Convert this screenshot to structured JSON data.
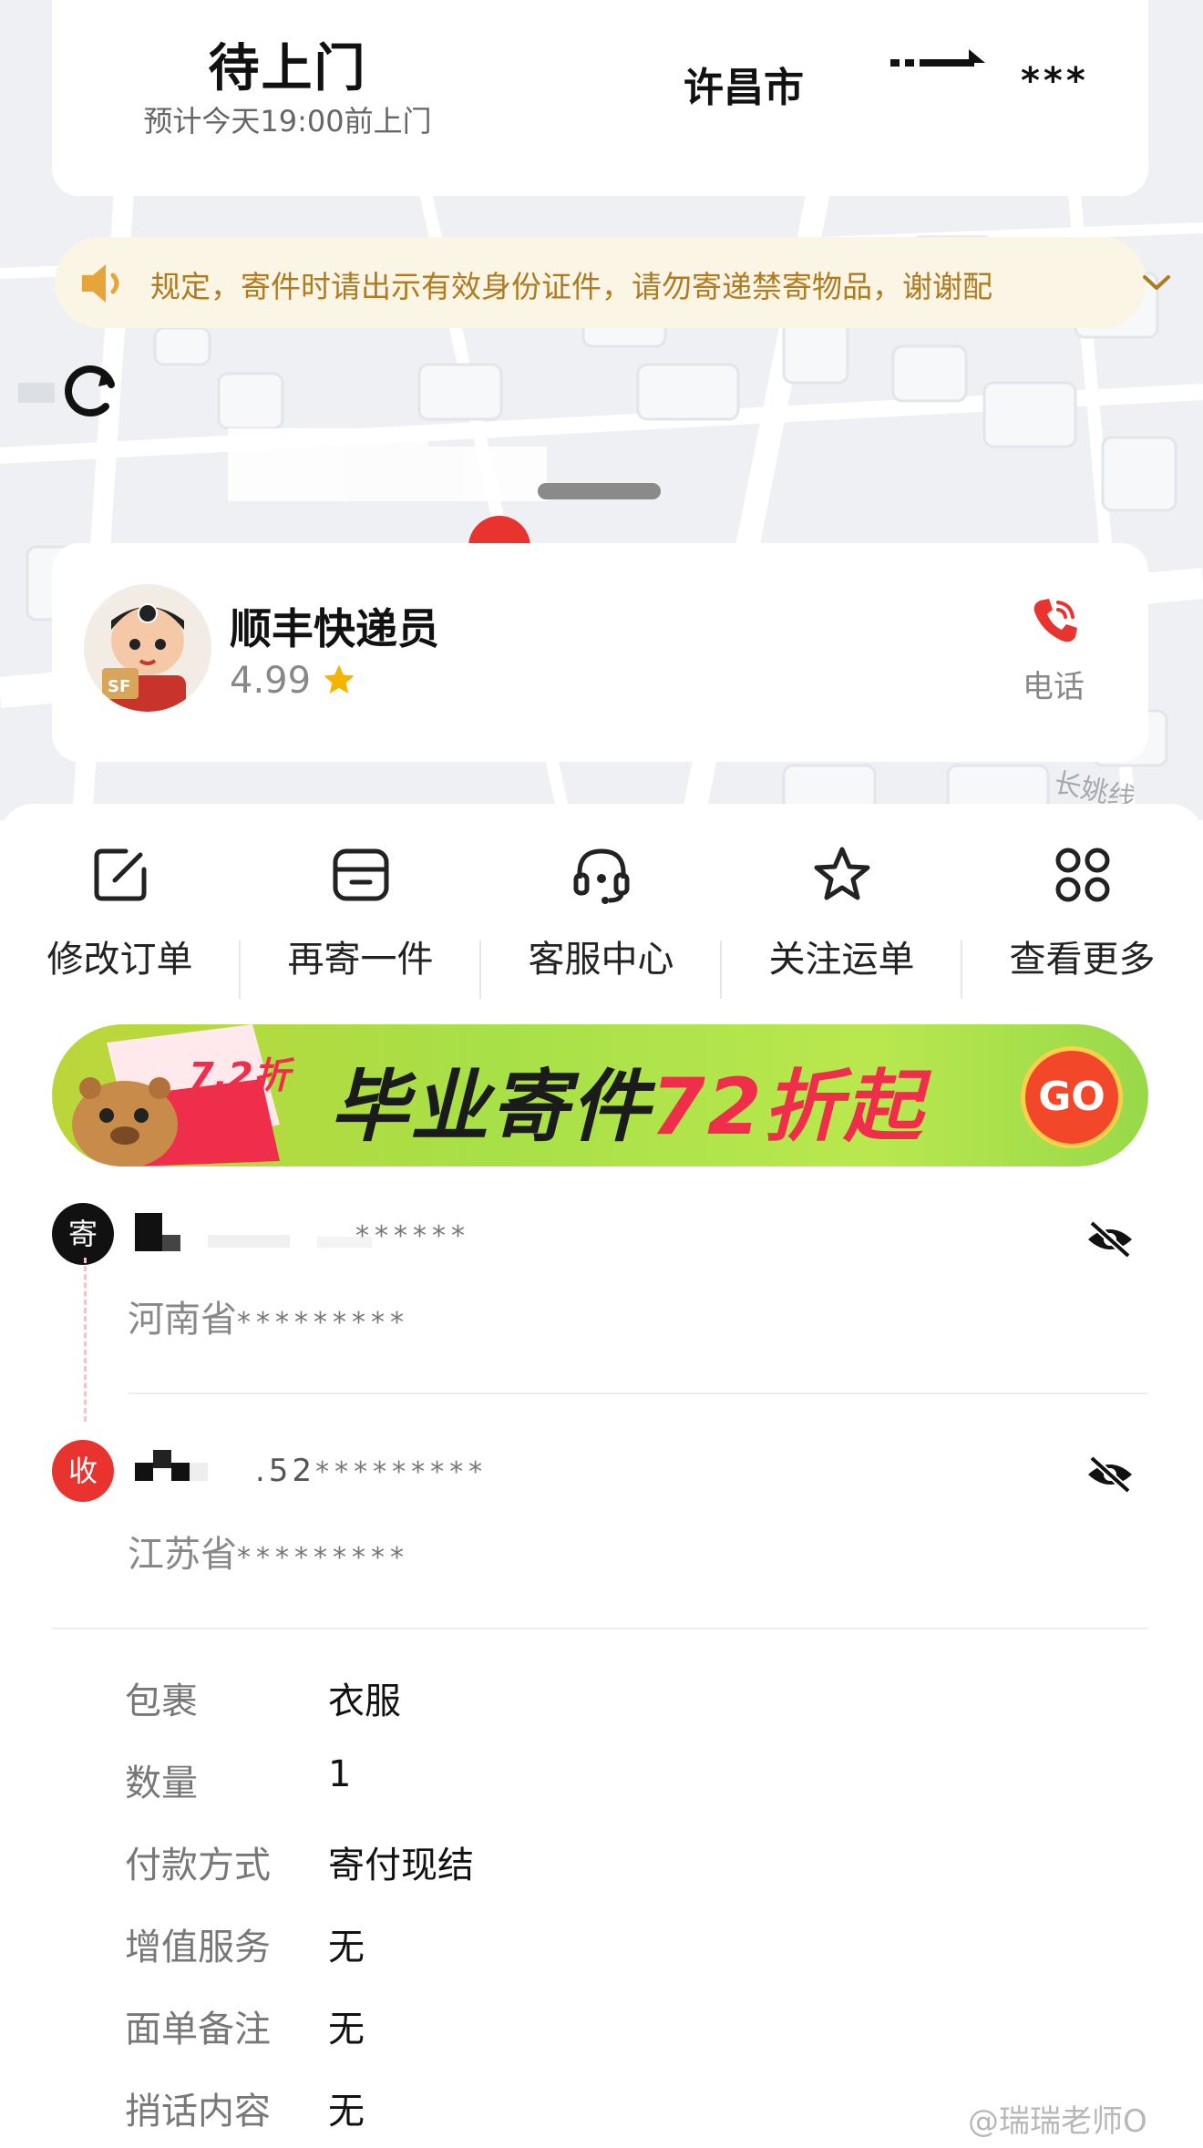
{
  "status": {
    "title": "待上门",
    "subtitle": "预计今天19:00前上门",
    "origin_city": "许昌市",
    "destination_masked": "***"
  },
  "notice": {
    "text": "规定，寄件时请出示有效身份证件，请勿寄递禁寄物品，谢谢配"
  },
  "map": {
    "road_label": "长姚线"
  },
  "courier": {
    "name": "顺丰快递员",
    "rating": "4.99",
    "phone_label": "电话"
  },
  "actions": [
    {
      "label": "修改订单",
      "icon": "edit-icon"
    },
    {
      "label": "再寄一件",
      "icon": "box-icon"
    },
    {
      "label": "客服中心",
      "icon": "headset-icon"
    },
    {
      "label": "关注运单",
      "icon": "star-icon"
    },
    {
      "label": "查看更多",
      "icon": "grid-icon"
    }
  ],
  "banner": {
    "text_prefix": "毕业寄件",
    "text_highlight": "72折起",
    "badge": "7.2折",
    "go_label": "GO"
  },
  "sender": {
    "badge": "寄",
    "phone_masked": "******",
    "province": "河南省",
    "address_masked": "*********"
  },
  "receiver": {
    "badge": "收",
    "phone_partial": ".52",
    "phone_masked": "*********",
    "province": "江苏省",
    "address_masked": "*********"
  },
  "details": [
    {
      "label": "包裹",
      "value": "衣服"
    },
    {
      "label": "数量",
      "value": "1"
    },
    {
      "label": "付款方式",
      "value": "寄付现结"
    },
    {
      "label": "增值服务",
      "value": "无"
    },
    {
      "label": "面单备注",
      "value": "无"
    },
    {
      "label": "捎话内容",
      "value": "无"
    }
  ],
  "watermark": "@瑞瑞老师O",
  "colors": {
    "accent_red": "#e8332e",
    "notice_text": "#b07a1f",
    "notice_bg": "#fbf5e6",
    "star": "#f5b400"
  }
}
